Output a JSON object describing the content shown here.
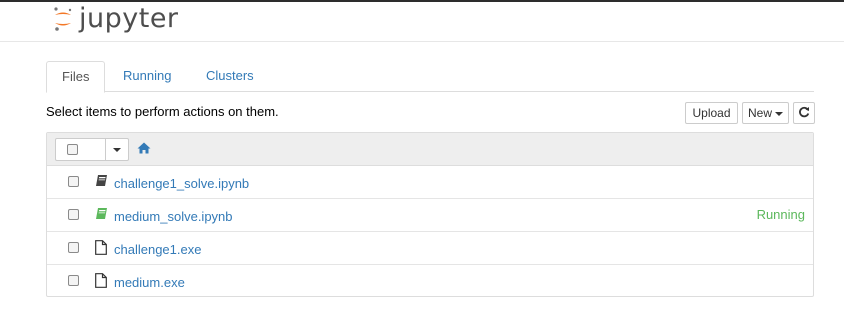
{
  "app": {
    "logo_text": "jupyter"
  },
  "tabs": [
    {
      "label": "Files",
      "active": true
    },
    {
      "label": "Running",
      "active": false
    },
    {
      "label": "Clusters",
      "active": false
    }
  ],
  "toolbar": {
    "instructions": "Select items to perform actions on them.",
    "upload_label": "Upload",
    "new_label": "New",
    "refresh_icon": "refresh-icon"
  },
  "list_header": {
    "home_icon": "home-icon"
  },
  "files": [
    {
      "name": "challenge1_solve.ipynb",
      "type": "notebook",
      "status": ""
    },
    {
      "name": "medium_solve.ipynb",
      "type": "notebook",
      "status": "Running"
    },
    {
      "name": "challenge1.exe",
      "type": "file",
      "status": ""
    },
    {
      "name": "medium.exe",
      "type": "file",
      "status": ""
    }
  ],
  "colors": {
    "link": "#337ab7",
    "running": "#5cb85c",
    "logo_orange": "#f37726",
    "notebook_running": "#5cb85c"
  }
}
